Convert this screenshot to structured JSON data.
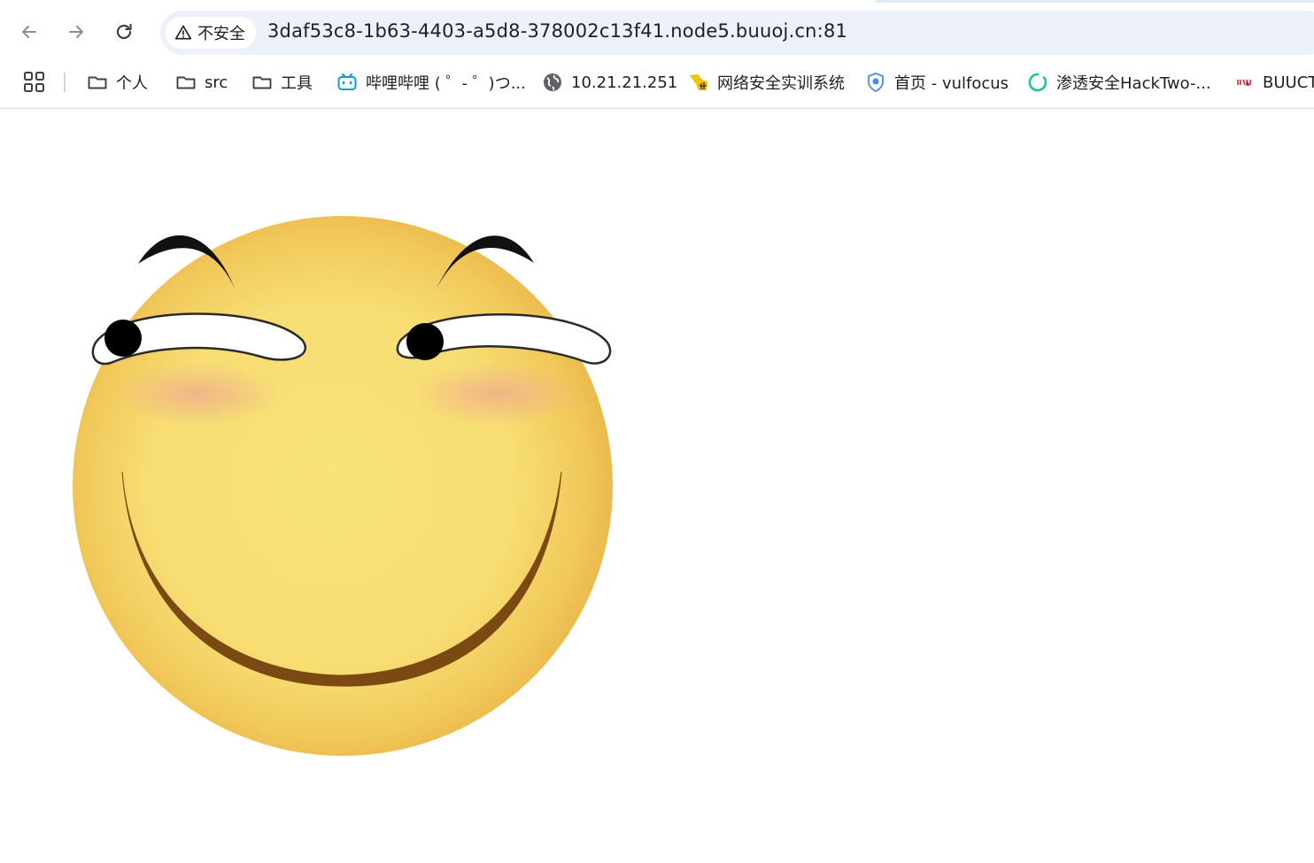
{
  "browser": {
    "nav": {
      "back_icon": "arrow-left-icon",
      "forward_icon": "arrow-right-icon",
      "reload_icon": "reload-icon"
    },
    "omnibox": {
      "security_label": "不安全",
      "security_icon": "warning-triangle-icon",
      "url": "3daf53c8-1b63-4403-a5d8-378002c13f41.node5.buuoj.cn:81"
    },
    "bookmarks": {
      "apps_icon": "apps-grid-icon",
      "items": [
        {
          "label": "个人",
          "icon": "folder-icon"
        },
        {
          "label": "src",
          "icon": "folder-icon"
        },
        {
          "label": "工具",
          "icon": "folder-icon"
        },
        {
          "label": "哔哩哔哩 ( ゜- ゜)つ...",
          "icon": "bilibili-icon"
        },
        {
          "label": "10.21.21.251",
          "icon": "globe-icon"
        },
        {
          "label": "网络安全实训系统",
          "icon": "site-logo-icon"
        },
        {
          "label": "首页 - vulfocus",
          "icon": "shield-icon"
        },
        {
          "label": "渗透安全HackTwo-...",
          "icon": "ring-icon"
        },
        {
          "label": "BUUCT",
          "icon": "ctf-logo-icon"
        }
      ]
    }
  },
  "page": {
    "image": {
      "subject": "smirking-smiley-face",
      "colors": {
        "face": "#f7df72",
        "face_edge": "#e9b44a",
        "brow": "#111111",
        "mouth": "#7a4a12",
        "blush": "#f1b58c"
      }
    }
  }
}
